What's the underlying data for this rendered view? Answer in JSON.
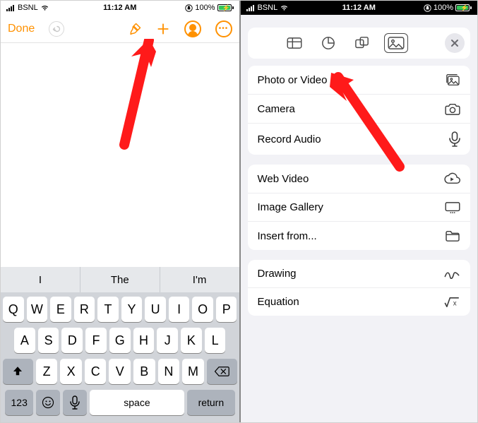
{
  "status": {
    "carrier": "BSNL",
    "time": "11:12 AM",
    "battery": "100%"
  },
  "left": {
    "toolbar": {
      "done": "Done"
    },
    "suggestions": [
      "I",
      "The",
      "I'm"
    ],
    "rows": [
      [
        "Q",
        "W",
        "E",
        "R",
        "T",
        "Y",
        "U",
        "I",
        "O",
        "P"
      ],
      [
        "A",
        "S",
        "D",
        "F",
        "G",
        "H",
        "J",
        "K",
        "L"
      ],
      [
        "Z",
        "X",
        "C",
        "V",
        "B",
        "N",
        "M"
      ]
    ],
    "bottom": {
      "numbers": "123",
      "space": "space",
      "ret": "return"
    }
  },
  "right": {
    "groups": [
      [
        {
          "label": "Photo or Video",
          "icon": "photo"
        },
        {
          "label": "Camera",
          "icon": "camera"
        },
        {
          "label": "Record Audio",
          "icon": "mic"
        }
      ],
      [
        {
          "label": "Web Video",
          "icon": "cloud"
        },
        {
          "label": "Image Gallery",
          "icon": "gallery"
        },
        {
          "label": "Insert from...",
          "icon": "folder"
        }
      ],
      [
        {
          "label": "Drawing",
          "icon": "scribble"
        },
        {
          "label": "Equation",
          "icon": "sqrt"
        }
      ]
    ]
  }
}
